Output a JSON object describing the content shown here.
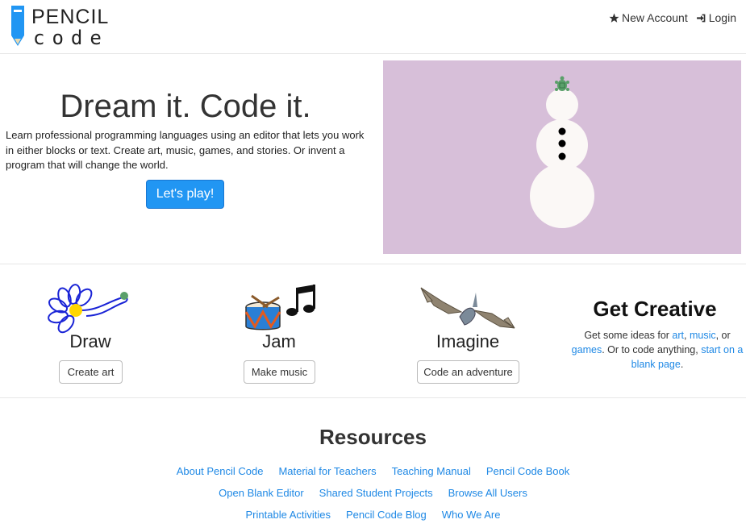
{
  "header": {
    "logo_line1": "PENCIL",
    "logo_line2": "code",
    "nav": {
      "new_account": "New Account",
      "login": "Login"
    }
  },
  "hero": {
    "title": "Dream it. Code it.",
    "description": "Learn professional programming languages using an editor that lets you work in either blocks or text. Create art, music, games, and stories. Or invent a program that will change the world.",
    "play_button": "Let's play!"
  },
  "features": [
    {
      "title": "Draw",
      "button": "Create art"
    },
    {
      "title": "Jam",
      "button": "Make music"
    },
    {
      "title": "Imagine",
      "button": "Code an adventure"
    }
  ],
  "creative": {
    "title": "Get Creative",
    "text_1": "Get some ideas for ",
    "link_art": "art",
    "sep_1": ", ",
    "link_music": "music",
    "sep_2": ", or ",
    "link_games": "games",
    "text_2": ". Or to code anything, ",
    "link_blank": "start on a blank page",
    "text_3": "."
  },
  "resources": {
    "title": "Resources",
    "row1": [
      "About Pencil Code",
      "Material for Teachers",
      "Teaching Manual",
      "Pencil Code Book"
    ],
    "row2": [
      "Open Blank Editor",
      "Shared Student Projects",
      "Browse All Users"
    ],
    "row3": [
      "Printable Activities",
      "Pencil Code Blog",
      "Who We Are"
    ]
  },
  "colors": {
    "accent": "#2196f3",
    "link": "#1e88e5",
    "hero_bg": "#d7bfd9"
  }
}
